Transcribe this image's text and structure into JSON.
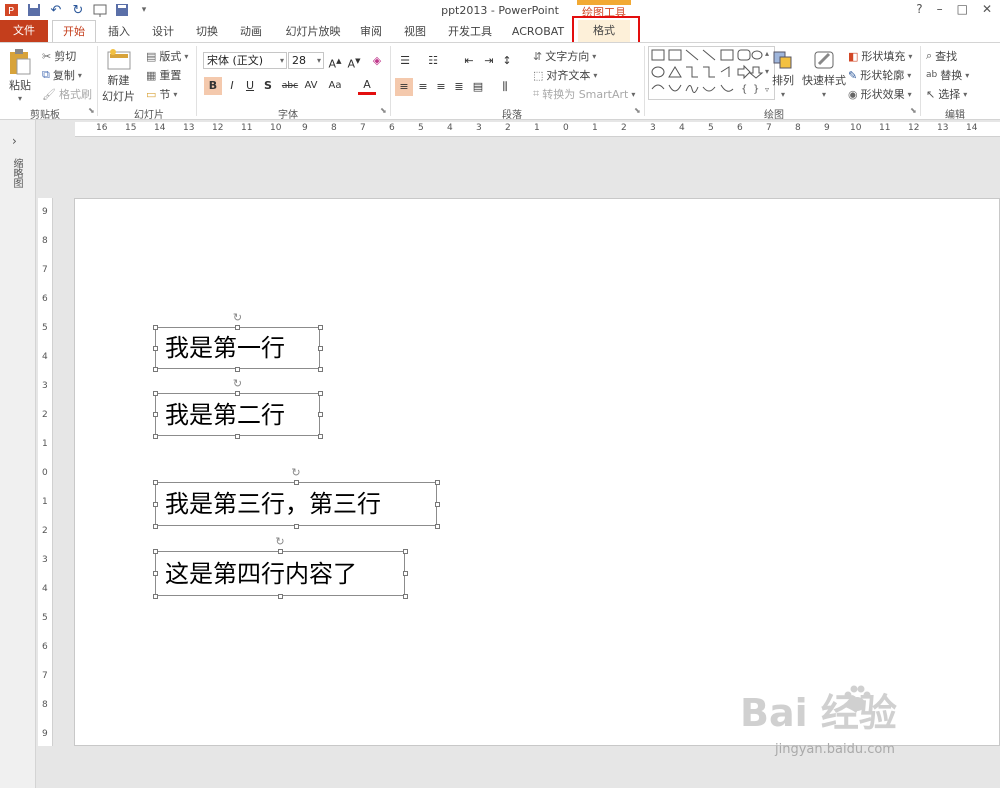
{
  "window": {
    "title": "ppt2013 - PowerPoint",
    "help": "?",
    "controls": [
      "–",
      "□",
      "✕"
    ]
  },
  "context_group": {
    "label": "绘图工具"
  },
  "tabs": [
    {
      "id": "file",
      "label": "文件"
    },
    {
      "id": "home",
      "label": "开始"
    },
    {
      "id": "insert",
      "label": "插入"
    },
    {
      "id": "design",
      "label": "设计"
    },
    {
      "id": "transitions",
      "label": "切换"
    },
    {
      "id": "animations",
      "label": "动画"
    },
    {
      "id": "slideshow",
      "label": "幻灯片放映"
    },
    {
      "id": "review",
      "label": "审阅"
    },
    {
      "id": "view",
      "label": "视图"
    },
    {
      "id": "developer",
      "label": "开发工具"
    },
    {
      "id": "acrobat",
      "label": "ACROBAT"
    },
    {
      "id": "format",
      "label": "格式"
    }
  ],
  "ribbon": {
    "clipboard": {
      "label": "剪贴板",
      "paste": "粘贴",
      "cut": "剪切",
      "copy": "复制",
      "format_painter": "格式刷"
    },
    "slides": {
      "label": "幻灯片",
      "new_slide_line1": "新建",
      "new_slide_line2": "幻灯片",
      "layout": "版式",
      "reset": "重置",
      "section": "节"
    },
    "font": {
      "label": "字体",
      "font_name": "宋体 (正文)",
      "font_size": "28",
      "bold": "B",
      "italic": "I",
      "underline": "U",
      "shadow": "S",
      "strike": "abc",
      "spacing": "AV",
      "case": "Aa",
      "color": "A"
    },
    "paragraph": {
      "label": "段落",
      "text_direction": "文字方向",
      "align_text": "对齐文本",
      "smartart": "转换为 SmartArt"
    },
    "drawing": {
      "label": "绘图",
      "arrange": "排列",
      "quick_styles": "快速样式",
      "shape_fill": "形状填充",
      "shape_outline": "形状轮廓",
      "shape_effects": "形状效果"
    },
    "editing": {
      "label": "编辑",
      "find": "查找",
      "replace": "替换",
      "select": "选择"
    }
  },
  "left_pane": {
    "label": "缩略图"
  },
  "rulers": {
    "horizontal": [
      "16",
      "15",
      "14",
      "13",
      "12",
      "11",
      "10",
      "9",
      "8",
      "7",
      "6",
      "5",
      "4",
      "3",
      "2",
      "1",
      "0",
      "1",
      "2",
      "3",
      "4",
      "5",
      "6",
      "7",
      "8",
      "9",
      "10",
      "11",
      "12",
      "13",
      "14",
      "15",
      "16"
    ],
    "vertical": [
      "9",
      "8",
      "7",
      "6",
      "5",
      "4",
      "3",
      "2",
      "1",
      "0",
      "1",
      "2",
      "3",
      "4",
      "5",
      "6",
      "7",
      "8",
      "9"
    ]
  },
  "slide": {
    "textboxes": [
      {
        "text": "我是第一行"
      },
      {
        "text": "我是第二行"
      },
      {
        "text": "我是第三行，第三行"
      },
      {
        "text": "这是第四行内容了"
      }
    ]
  },
  "watermark": {
    "brand": "Bai  经验",
    "url": "jingyan.baidu.com"
  },
  "colors": {
    "accent": "#c43e1c",
    "context": "#f2a933",
    "highlight": "#e30e0e"
  }
}
